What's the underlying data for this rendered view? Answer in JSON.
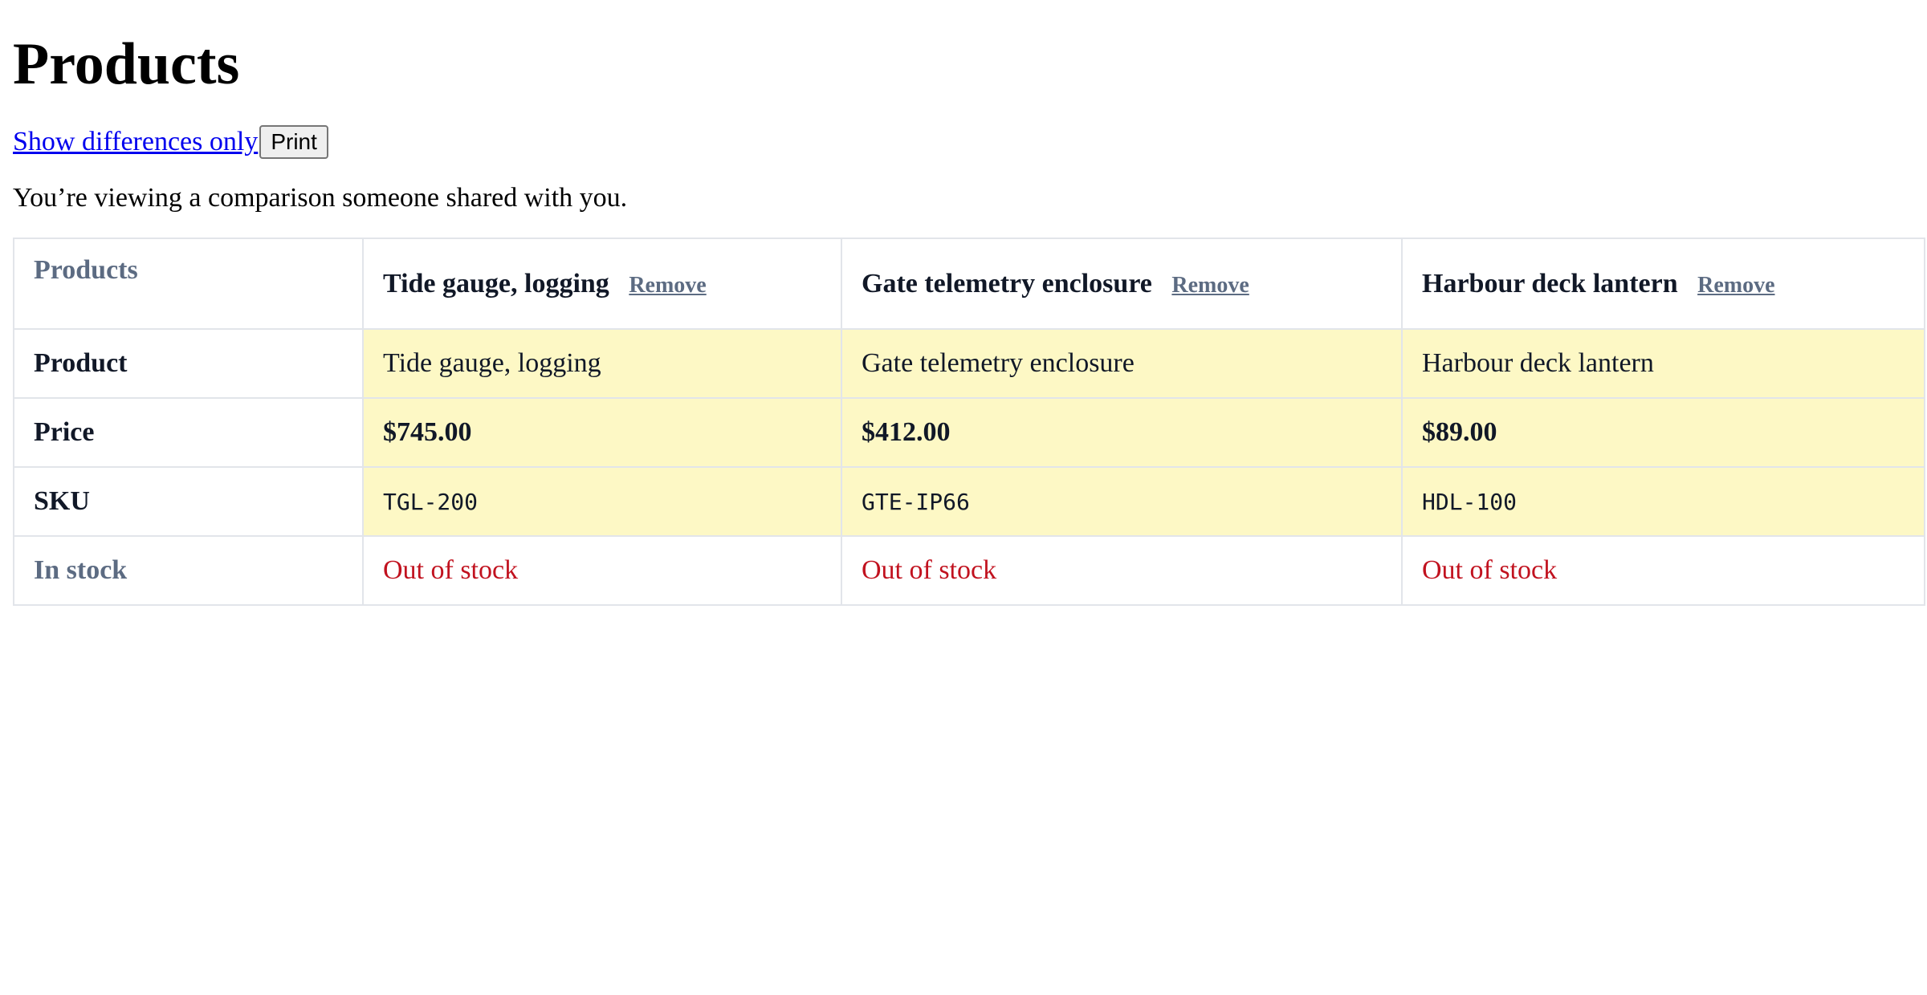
{
  "page": {
    "title": "Products",
    "show_differences_label": "Show differences only ",
    "print_label": "Print",
    "notice": "You’re viewing a comparison someone shared with you."
  },
  "table": {
    "corner_label": "Products",
    "remove_label": "Remove",
    "products": [
      {
        "header_name": "Tide gauge, logging",
        "product": "Tide gauge, logging",
        "price": "$745.00",
        "sku": "TGL-200",
        "stock": "Out of stock"
      },
      {
        "header_name": "Gate telemetry enclosure",
        "product": "Gate telemetry enclosure",
        "price": "$412.00",
        "sku": "GTE-IP66",
        "stock": "Out of stock"
      },
      {
        "header_name": "Harbour deck lantern",
        "product": "Harbour deck lantern",
        "price": "$89.00",
        "sku": "HDL-100",
        "stock": "Out of stock"
      }
    ],
    "row_labels": {
      "product": "Product",
      "price": "Price",
      "sku": "SKU",
      "stock": "In stock"
    }
  },
  "colors": {
    "diff_highlight": "#fdf8c5",
    "muted_label": "#5c6b82",
    "out_of_stock": "#c1121f",
    "link": "#0000ee",
    "border": "#e2e5ea"
  }
}
